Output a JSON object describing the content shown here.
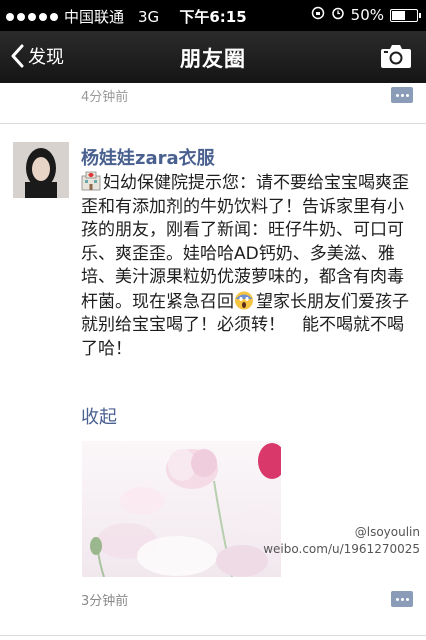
{
  "status_bar": {
    "carrier": "中国联通",
    "network": "3G",
    "time": "下午6:15",
    "battery": "50%",
    "battery_level": 0.5
  },
  "nav": {
    "back_label": "发现",
    "title": "朋友圈"
  },
  "previous_post": {
    "time": "4分钟前"
  },
  "post": {
    "author": "杨娃娃zara衣服",
    "text": "妇幼保健院提示您：请不要给宝宝喝爽歪歪和有添加剂的牛奶饮料了！告诉家里有小孩的朋友，刚看了新闻：旺仔牛奶、可口可乐、爽歪歪。娃哈哈AD钙奶、多美滋、雅培、美汁源果粒奶优菠萝味的，都含有肉毒杆菌。现在紧急召回",
    "text_after_emoji": "望家长朋友们爱孩子 就别给宝宝喝了！必须转！　能不喝就不喝了哈！",
    "collapse_label": "收起",
    "time": "3分钟前"
  },
  "watermark": {
    "handle": "@lsoyoulin",
    "url": "weibo.com/u/1961270025"
  },
  "colors": {
    "link": "#4a6190",
    "status_bg": "#000000",
    "nav_bg": "#1e1e1e"
  }
}
